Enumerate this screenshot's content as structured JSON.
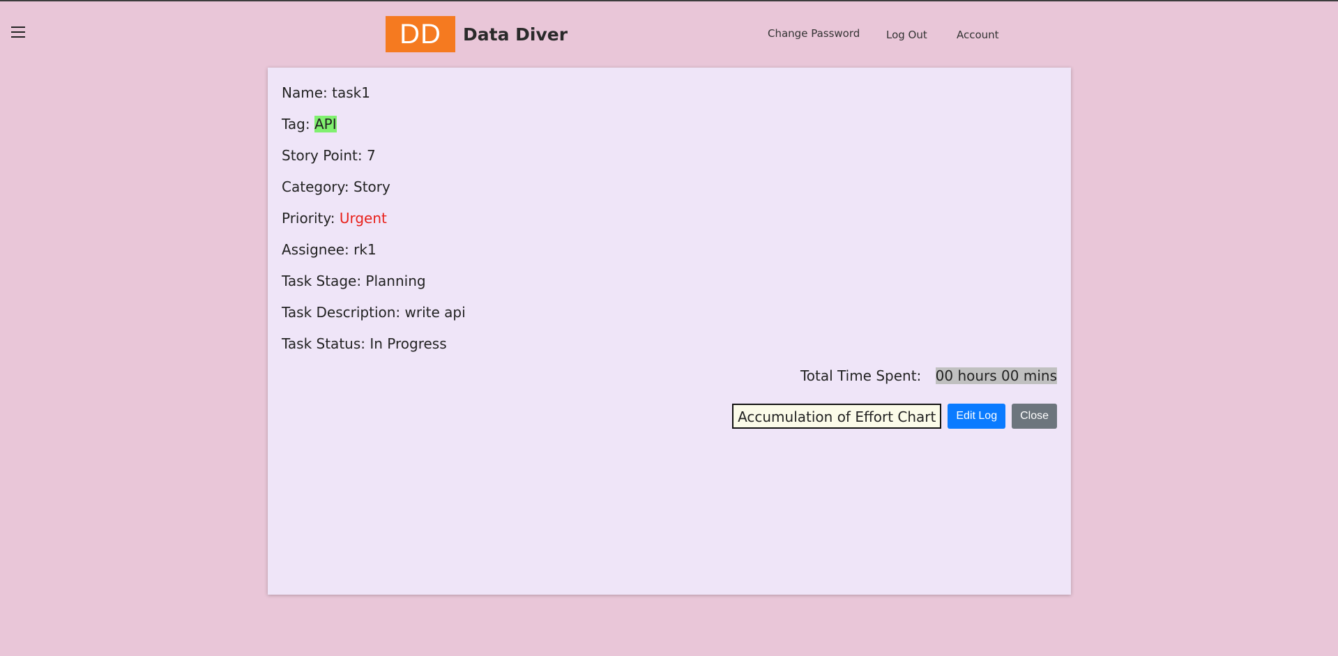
{
  "header": {
    "menu_icon": "hamburger-menu-icon",
    "logo_text": "DD",
    "brand_name": "Data Diver",
    "nav": {
      "change_password": "Change Password",
      "log_out": "Log Out",
      "account": "Account"
    }
  },
  "task": {
    "name_label": "Name:",
    "name_value": "task1",
    "tag_label": "Tag:",
    "tag_value": "API",
    "story_point_label": "Story Point:",
    "story_point_value": "7",
    "category_label": "Category:",
    "category_value": "Story",
    "priority_label": "Priority:",
    "priority_value": "Urgent",
    "assignee_label": "Assignee:",
    "assignee_value": "rk1",
    "stage_label": "Task Stage:",
    "stage_value": "Planning",
    "description_label": "Task Description:",
    "description_value": "write api",
    "status_label": "Task Status:",
    "status_value": "In Progress",
    "time_label": "Total Time Spent:",
    "time_value": "00 hours 00 mins"
  },
  "actions": {
    "chart_label": "Accumulation of Effort Chart",
    "edit_label": "Edit Log",
    "close_label": "Close"
  },
  "colors": {
    "background": "#e9c6d8",
    "card": "#efe5f8",
    "logo": "#f57a20",
    "tag_highlight": "#80f06f",
    "priority_urgent": "#e8201a",
    "time_highlight": "#c0c0c0",
    "edit_button": "#0a7bff",
    "close_button": "#6c757d"
  }
}
